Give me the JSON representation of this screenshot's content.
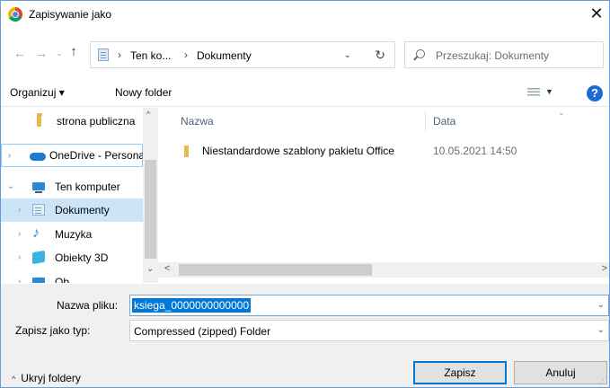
{
  "window": {
    "title": "Zapisywanie jako",
    "close_glyph": "✕"
  },
  "navigation": {
    "back_glyph": "←",
    "forward_glyph": "→",
    "recent_glyph": "⌄",
    "up_glyph": "↑",
    "breadcrumb": [
      "Ten ko...",
      "Dokumenty"
    ],
    "breadcrumb_sep": "›",
    "address_dropdown_glyph": "⌄",
    "refresh_glyph": "↻",
    "search_placeholder": "Przeszukaj: Dokumenty"
  },
  "toolbar": {
    "organize_label": "Organizuj ▾",
    "new_folder_label": "Nowy folder",
    "view_dropdown_glyph": "▼",
    "help_glyph": "?"
  },
  "sidebar": {
    "items": [
      {
        "label": "strona publiczna",
        "expander": ""
      },
      {
        "label": "OneDrive - Personal",
        "expander": "›"
      },
      {
        "label": "Ten komputer",
        "expander": "⌄"
      },
      {
        "label": "Dokumenty",
        "expander": "›"
      },
      {
        "label": "Muzyka",
        "expander": "›"
      },
      {
        "label": "Obiekty 3D",
        "expander": "›"
      },
      {
        "label": "Ob...",
        "expander": "›"
      }
    ],
    "scroll_up_glyph": "^",
    "scroll_down_glyph": "⌄"
  },
  "file_list": {
    "columns": [
      "Nazwa",
      "Data"
    ],
    "sort_glyph": "⌄",
    "rows": [
      {
        "name": "Niestandardowe szablony pakietu Office",
        "date": "10.05.2021 14:50"
      }
    ],
    "scroll_left_glyph": "<",
    "scroll_right_glyph": ">"
  },
  "form": {
    "filename_label": "Nazwa pliku:",
    "filename_value": "ksiega_0000000000000",
    "type_label": "Zapisz jako typ:",
    "type_value": "Compressed (zipped) Folder",
    "dropdown_glyph": "⌄"
  },
  "footer": {
    "hide_folders_glyph": "^",
    "hide_folders_label": "Ukryj foldery",
    "save_label": "Zapisz",
    "cancel_label": "Anuluj"
  },
  "colors": {
    "selection": "#0078d7",
    "nav_selected": "#cce4f7",
    "folder": "#e8b84a",
    "help": "#1d6bd2"
  }
}
